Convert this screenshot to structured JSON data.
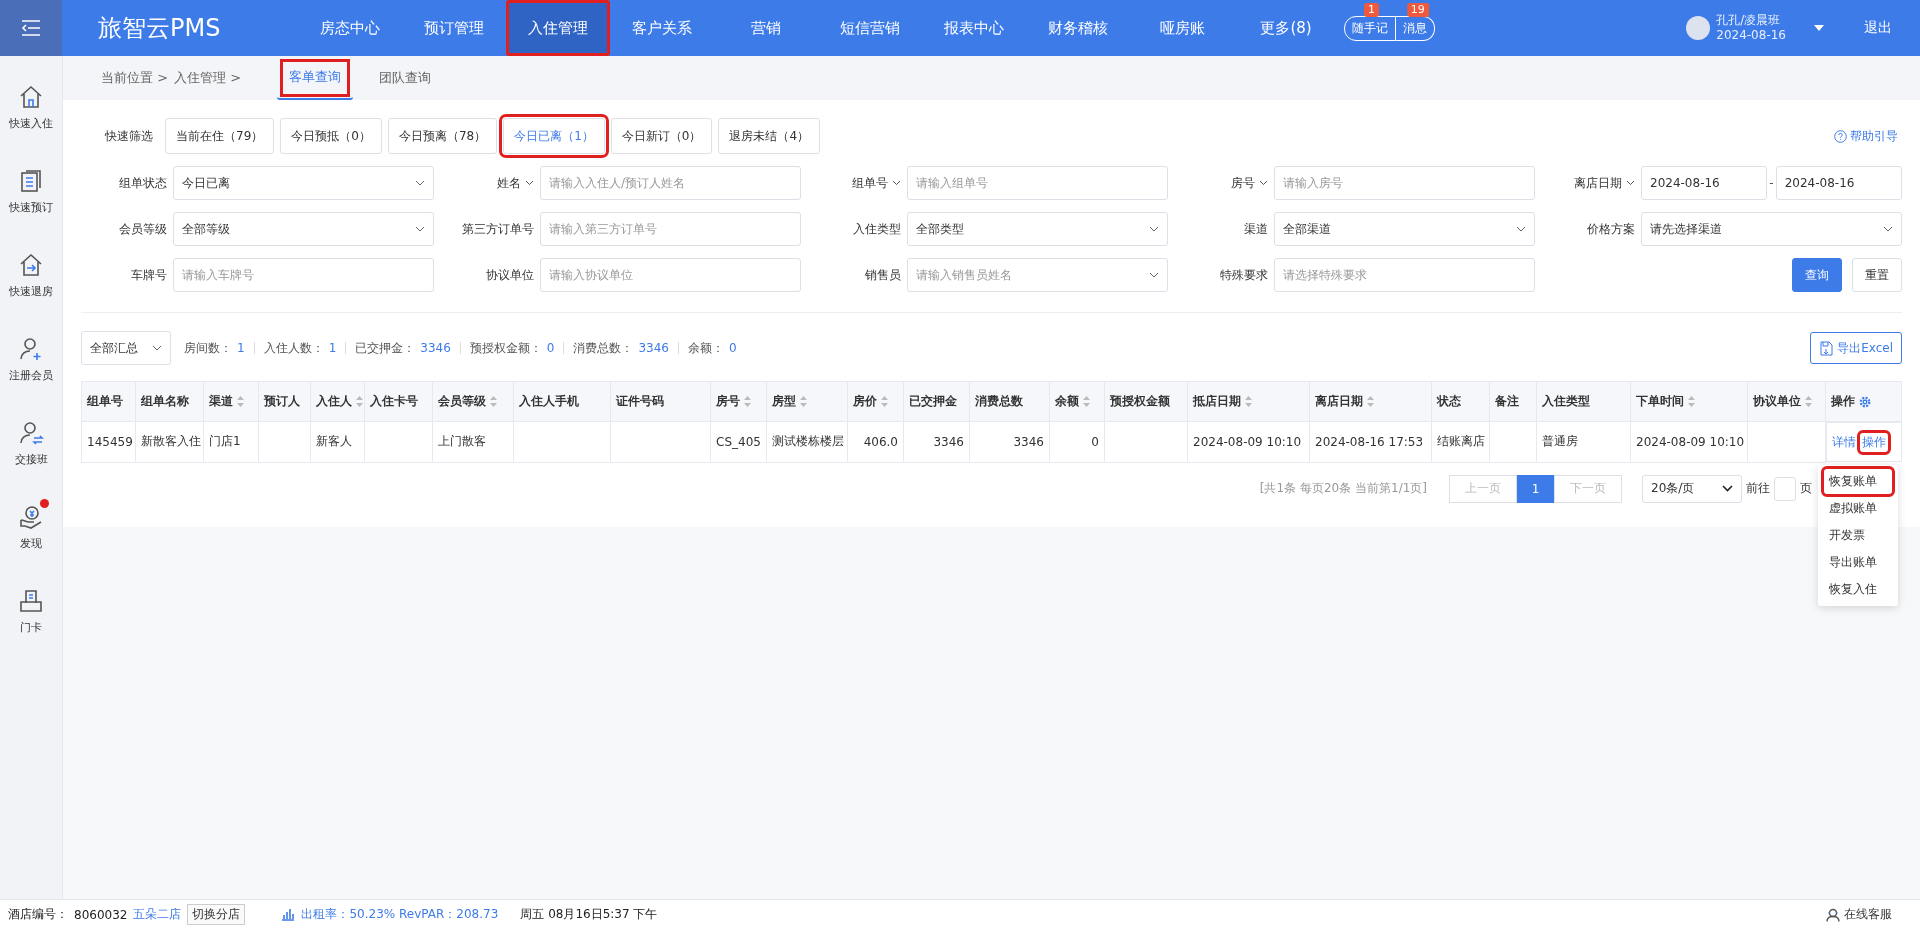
{
  "app": {
    "logo": "旅智云PMS"
  },
  "nav": [
    {
      "label": "房态中心",
      "selected": false,
      "highlighted": false
    },
    {
      "label": "预订管理",
      "selected": false,
      "highlighted": false
    },
    {
      "label": "入住管理",
      "selected": true,
      "highlighted": true
    },
    {
      "label": "客户关系",
      "selected": false,
      "highlighted": false
    },
    {
      "label": "营销",
      "selected": false,
      "highlighted": false
    },
    {
      "label": "短信营销",
      "selected": false,
      "highlighted": false
    },
    {
      "label": "报表中心",
      "selected": false,
      "highlighted": false
    },
    {
      "label": "财务稽核",
      "selected": false,
      "highlighted": false
    },
    {
      "label": "哑房账",
      "selected": false,
      "highlighted": false
    },
    {
      "label": "更多(8)",
      "selected": false,
      "highlighted": false
    }
  ],
  "header_buttons": [
    {
      "label": "随手记",
      "badge": "1"
    },
    {
      "label": "消息",
      "badge": "19"
    }
  ],
  "user": {
    "name": "孔孔/凌晨班",
    "date": "2024-08-16"
  },
  "logout": "退出",
  "sidebar": [
    {
      "label": "快速入住",
      "kind": "home",
      "dot": false
    },
    {
      "label": "快速预订",
      "kind": "doc",
      "dot": false
    },
    {
      "label": "快速退房",
      "kind": "checkout",
      "dot": false
    },
    {
      "label": "注册会员",
      "kind": "useradd",
      "dot": false
    },
    {
      "label": "交接班",
      "kind": "userswap",
      "dot": false
    },
    {
      "label": "发现",
      "kind": "money",
      "dot": true
    },
    {
      "label": "门卡",
      "kind": "card",
      "dot": false
    }
  ],
  "breadcrumb": [
    "当前位置 >",
    "入住管理 >"
  ],
  "tabs": [
    {
      "label": "客单查询",
      "selected": true,
      "highlighted": true
    },
    {
      "label": "团队查询",
      "selected": false,
      "highlighted": false
    }
  ],
  "help": "帮助引导",
  "quick_filter": {
    "label": "快速筛选",
    "items": [
      {
        "label": "当前在住（79）",
        "selected": false,
        "highlighted": false
      },
      {
        "label": "今日预抵（0）",
        "selected": false,
        "highlighted": false
      },
      {
        "label": "今日预离（78）",
        "selected": false,
        "highlighted": false
      },
      {
        "label": "今日已离（1）",
        "selected": true,
        "highlighted": true
      },
      {
        "label": "今日新订（0）",
        "selected": false,
        "highlighted": false
      },
      {
        "label": "退房未结（4）",
        "selected": false,
        "highlighted": false
      }
    ]
  },
  "filters": [
    {
      "label": "组单状态",
      "label_dropdown": false,
      "kind": "select",
      "value": "今日已离"
    },
    {
      "label": "姓名",
      "label_dropdown": true,
      "kind": "input",
      "placeholder": "请输入入住人/预订人姓名"
    },
    {
      "label": "组单号",
      "label_dropdown": true,
      "kind": "input",
      "placeholder": "请输入组单号"
    },
    {
      "label": "房号",
      "label_dropdown": true,
      "kind": "input",
      "placeholder": "请输入房号"
    },
    {
      "label": "离店日期",
      "label_dropdown": true,
      "kind": "range",
      "from": "2024-08-16",
      "separator": "-",
      "to": "2024-08-16"
    },
    {
      "label": "会员等级",
      "label_dropdown": false,
      "kind": "select",
      "value": "全部等级"
    },
    {
      "label": "第三方订单号",
      "label_dropdown": false,
      "kind": "input",
      "placeholder": "请输入第三方订单号"
    },
    {
      "label": "入住类型",
      "label_dropdown": false,
      "kind": "select",
      "value": "全部类型"
    },
    {
      "label": "渠道",
      "label_dropdown": false,
      "kind": "select",
      "value": "全部渠道"
    },
    {
      "label": "价格方案",
      "label_dropdown": false,
      "kind": "select",
      "value": "请先选择渠道"
    },
    {
      "label": "车牌号",
      "label_dropdown": false,
      "kind": "input",
      "placeholder": "请输入车牌号"
    },
    {
      "label": "协议单位",
      "label_dropdown": false,
      "kind": "input",
      "placeholder": "请输入协议单位"
    },
    {
      "label": "销售员",
      "label_dropdown": false,
      "kind": "select",
      "placeholder": "请输入销售员姓名"
    },
    {
      "label": "特殊要求",
      "label_dropdown": false,
      "kind": "input",
      "placeholder": "请选择特殊要求"
    }
  ],
  "actions": {
    "search": "查询",
    "reset": "重置"
  },
  "summary": {
    "select": "全部汇总",
    "stats": [
      {
        "label": "房间数：",
        "value": "1"
      },
      {
        "label": "入住人数：",
        "value": "1"
      },
      {
        "label": "已交押金：",
        "value": "3346"
      },
      {
        "label": "预授权金额：",
        "value": "0"
      },
      {
        "label": "消费总数：",
        "value": "3346"
      },
      {
        "label": "余额：",
        "value": "0"
      }
    ],
    "export": "导出Excel"
  },
  "table": {
    "columns": [
      {
        "label": "组单号",
        "sortable": false
      },
      {
        "label": "组单名称",
        "sortable": false
      },
      {
        "label": "渠道",
        "sortable": true
      },
      {
        "label": "预订人",
        "sortable": false
      },
      {
        "label": "入住人",
        "sortable": true
      },
      {
        "label": "入住卡号",
        "sortable": false
      },
      {
        "label": "会员等级",
        "sortable": true
      },
      {
        "label": "入住人手机",
        "sortable": false
      },
      {
        "label": "证件号码",
        "sortable": false
      },
      {
        "label": "房号",
        "sortable": true
      },
      {
        "label": "房型",
        "sortable": true
      },
      {
        "label": "房价",
        "sortable": true
      },
      {
        "label": "已交押金",
        "sortable": false
      },
      {
        "label": "消费总数",
        "sortable": false
      },
      {
        "label": "余额",
        "sortable": true
      },
      {
        "label": "预授权金额",
        "sortable": false
      },
      {
        "label": "抵店日期",
        "sortable": true
      },
      {
        "label": "离店日期",
        "sortable": true
      },
      {
        "label": "状态",
        "sortable": false
      },
      {
        "label": "备注",
        "sortable": false
      },
      {
        "label": "入住类型",
        "sortable": false
      },
      {
        "label": "下单时间",
        "sortable": true
      },
      {
        "label": "协议单位",
        "sortable": true
      },
      {
        "label": "操作",
        "sortable": false
      }
    ],
    "rows": [
      {
        "cells": [
          "145459",
          "新散客入住",
          "门店1",
          "",
          "新客人",
          "",
          "上门散客",
          "",
          "",
          "CS_405",
          "测试楼栋楼层",
          "406.0",
          "3346",
          "3346",
          "0",
          "",
          "2024-08-09 10:10",
          "2024-08-16 17:53",
          "结账离店",
          "",
          "普通房",
          "2024-08-09 10:10",
          ""
        ],
        "links": [
          {
            "label": "详情",
            "highlighted": false
          },
          {
            "label": "操作",
            "highlighted": true
          }
        ]
      }
    ]
  },
  "pagination": {
    "info": "[共1条 每页20条 当前第1/1页]",
    "prev": "上一页",
    "pages": [
      {
        "label": "1",
        "selected": true
      }
    ],
    "next": "下一页",
    "page_size": "20条/页",
    "goto": "前往",
    "goto_suffix": "页"
  },
  "menu": [
    {
      "label": "恢复账单",
      "highlighted": true
    },
    {
      "label": "虚拟账单",
      "highlighted": false
    },
    {
      "label": "开发票",
      "highlighted": false
    },
    {
      "label": "导出账单",
      "highlighted": false
    },
    {
      "label": "恢复入住",
      "highlighted": false
    }
  ],
  "status_bar": {
    "hotel_label": "酒店编号：",
    "hotel_no": "8060032",
    "branch": "五朵二店",
    "switch": "切换分店",
    "occupancy": "出租率：50.23% RevPAR：208.73",
    "datetime": "周五 08月16日5:37 下午",
    "service": "在线客服"
  }
}
